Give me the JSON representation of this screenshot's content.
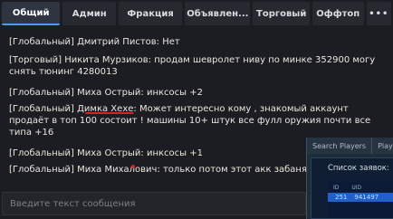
{
  "tabs": [
    {
      "label": "Общий",
      "active": true
    },
    {
      "label": "Админ"
    },
    {
      "label": "Фракция"
    },
    {
      "label": "Объявлен..."
    },
    {
      "label": "Торговый"
    },
    {
      "label": "Оффтоп"
    },
    {
      "label": "•••"
    }
  ],
  "messages": [
    {
      "text": "[Глобальный] Дмитрий Пистов: Нет"
    },
    {
      "text": "[Торговый] Никита Мурзиков: продам шевролет ниву по минке 352900 могу снять тюнинг 4280013"
    },
    {
      "text": "[Глобальный] Миха Острый: инксосы +2"
    },
    {
      "prefix": "[Глобальный] ",
      "name": "Димка Хехе",
      "body": ": Может интересно кому , знакомый аккаунт продаёт в топ 100 состоит ! машины 10+ штук все фулл оружия почти все типа +16"
    },
    {
      "text": "[Глобальный] Миха Острый: инксосы +1"
    },
    {
      "text": "[Глобальный] Миха Михалович: только потом этот акк забанят найух"
    }
  ],
  "input": {
    "placeholder": "Введите текст сообщения"
  },
  "overlay": {
    "tabs": [
      "Search Players",
      "Players"
    ],
    "title": "Список заявок:",
    "columns": [
      "ID",
      "UID"
    ],
    "row": [
      "251",
      "941497"
    ]
  },
  "colors": {
    "accent": "#4b9bf0",
    "underline": "#e02020",
    "selected_row": "#2060c8"
  }
}
